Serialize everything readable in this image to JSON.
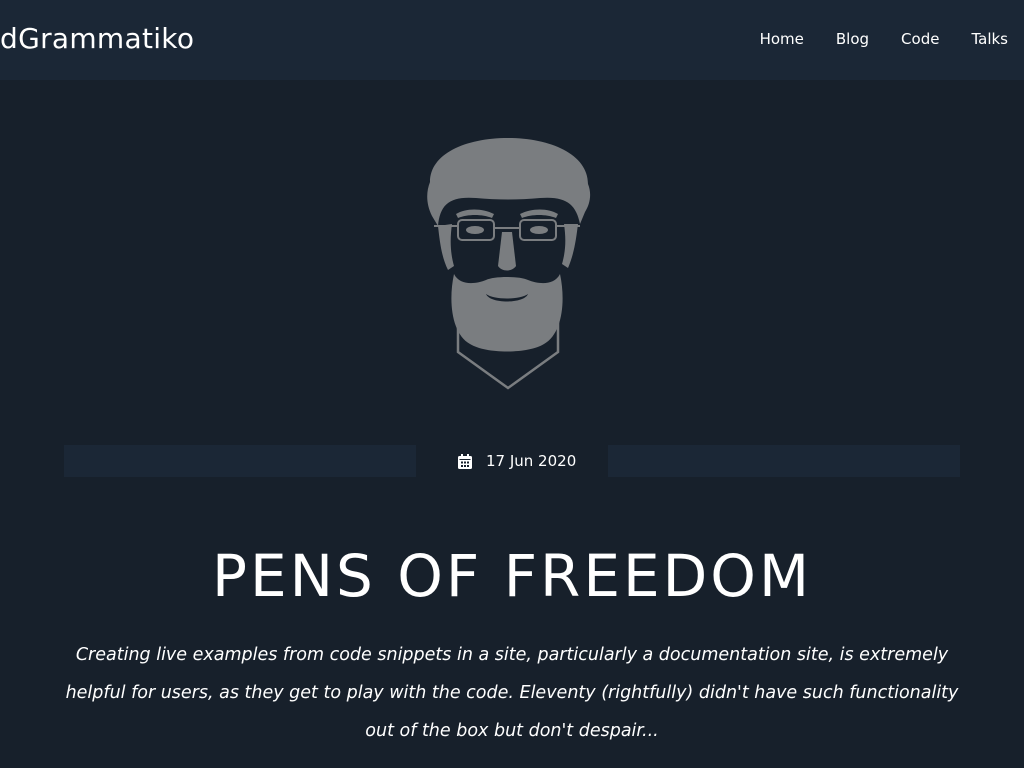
{
  "header": {
    "brand": "dGrammatiko",
    "nav": [
      {
        "label": "Home"
      },
      {
        "label": "Blog"
      },
      {
        "label": "Code"
      },
      {
        "label": "Talks"
      }
    ]
  },
  "avatar": {
    "icon": "avatar-illustration",
    "color": "#7a7d80"
  },
  "post": {
    "date_icon": "calendar-icon",
    "date": "17 Jun 2020",
    "title": "PENS OF FREEDOM",
    "excerpt": "Creating live examples from code snippets in a site, particularly a documentation site, is extremely helpful for users, as they get to play with the code. Eleventy (rightfully) didn't have such functionality out of the box but don't despair..."
  },
  "colors": {
    "background": "#17202b",
    "header_background": "#1b2736",
    "text": "#ffffff"
  }
}
